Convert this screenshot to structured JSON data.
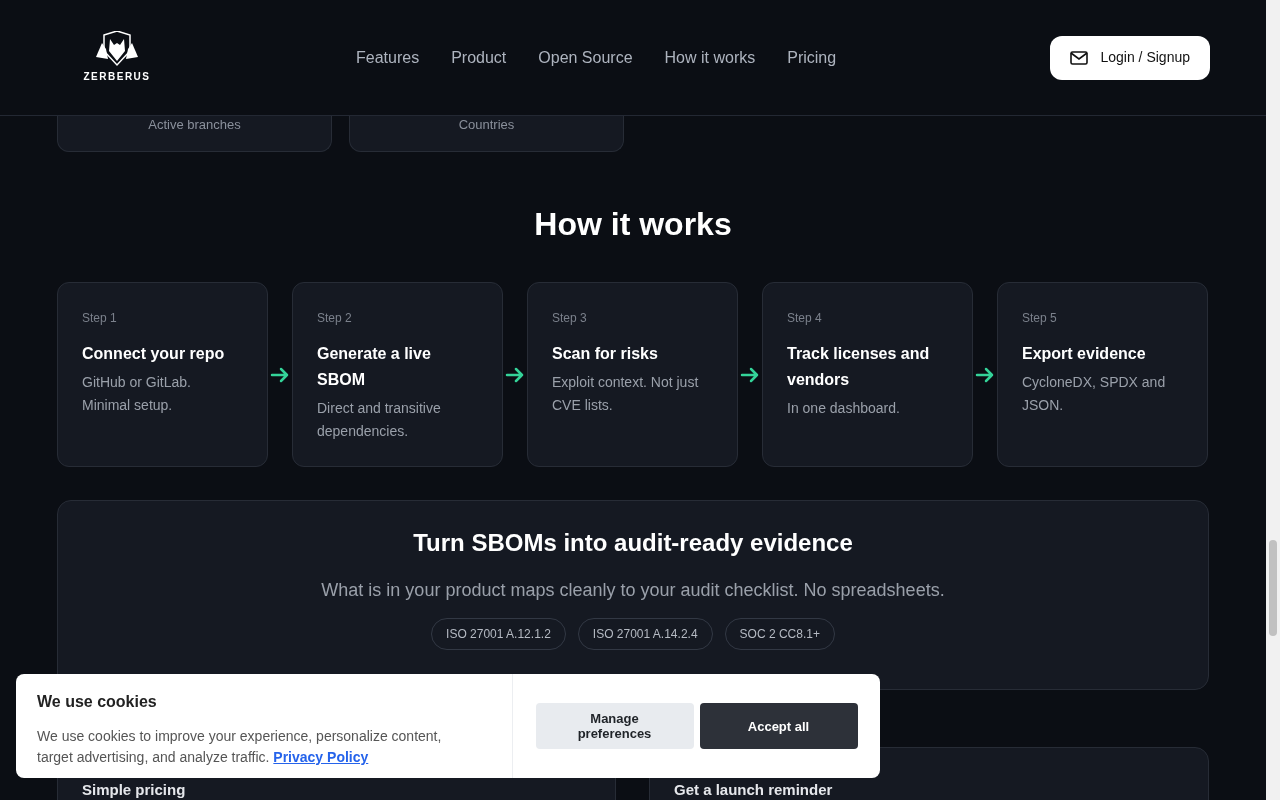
{
  "header": {
    "logo_text": "ZERBERUS",
    "nav": [
      "Features",
      "Product",
      "Open Source",
      "How it works",
      "Pricing"
    ],
    "login_button": "Login / Signup"
  },
  "stats": [
    "Active branches",
    "Countries"
  ],
  "how_it_works": {
    "title": "How it works",
    "steps": [
      {
        "step": "Step 1",
        "title": "Connect your repo",
        "text": "GitHub or GitLab. Minimal setup."
      },
      {
        "step": "Step 2",
        "title": "Generate a live SBOM",
        "text": "Direct and transitive dependencies."
      },
      {
        "step": "Step 3",
        "title": "Scan for risks",
        "text": "Exploit context. Not just CVE lists."
      },
      {
        "step": "Step 4",
        "title": "Track licenses and vendors",
        "text": "In one dashboard."
      },
      {
        "step": "Step 5",
        "title": "Export evidence",
        "text": "CycloneDX, SPDX and JSON."
      }
    ]
  },
  "evidence": {
    "title": "Turn SBOMs into audit-ready evidence",
    "subtitle": "What is in your product maps cleanly to your audit checklist. No spreadsheets.",
    "tags": [
      "ISO 27001 A.12.1.2",
      "ISO 27001 A.14.2.4",
      "SOC 2 CC8.1+"
    ]
  },
  "bottom_cards": [
    "Simple pricing",
    "Get a launch reminder"
  ],
  "cookie_banner": {
    "title": "We use cookies",
    "text": "We use cookies to improve your experience, personalize content, target advertising, and analyze traffic.",
    "link": "Privacy Policy",
    "buttons": [
      {
        "label": "Manage preferences",
        "kind": "secondary"
      },
      {
        "label": "Accept all",
        "kind": "primary"
      }
    ]
  }
}
